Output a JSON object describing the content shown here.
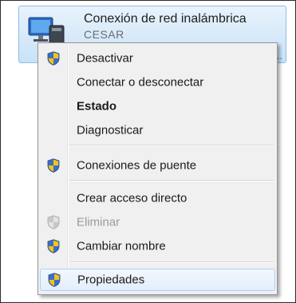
{
  "network": {
    "title": "Conexión de red inalámbrica",
    "subtitle": "CESAR",
    "truncated": "2..."
  },
  "menu": {
    "items": [
      {
        "label": "Desactivar",
        "icon": "shield-icon"
      },
      {
        "label": "Conectar o desconectar",
        "icon": null
      },
      {
        "label": "Estado",
        "icon": null,
        "bold": true
      },
      {
        "label": "Diagnosticar",
        "icon": null
      },
      {
        "label": "Conexiones de puente",
        "icon": "shield-icon"
      },
      {
        "label": "Crear acceso directo",
        "icon": null
      },
      {
        "label": "Eliminar",
        "icon": "shield-icon",
        "disabled": true
      },
      {
        "label": "Cambiar nombre",
        "icon": "shield-icon"
      },
      {
        "label": "Propiedades",
        "icon": "shield-icon",
        "highlighted": true
      }
    ]
  },
  "colors": {
    "shield_blue": "#3c6fc4",
    "shield_yellow": "#f2c318",
    "highlight_border": "#aecff5"
  }
}
